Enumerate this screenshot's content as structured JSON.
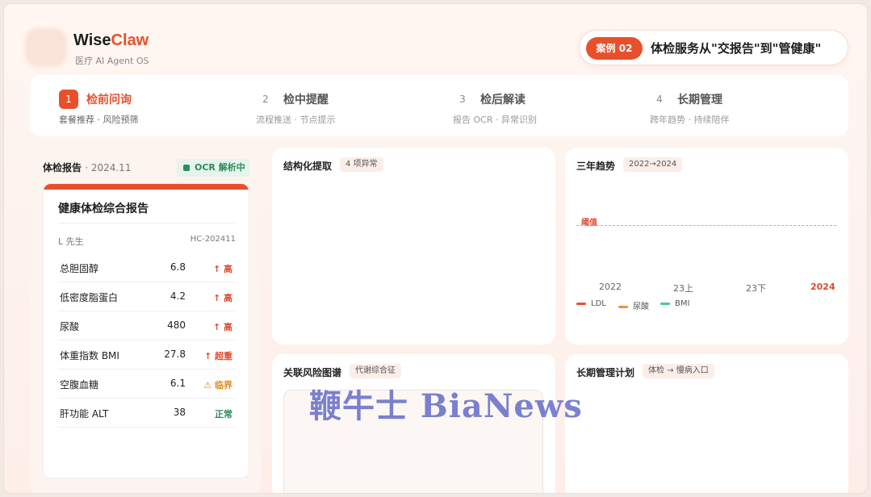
{
  "brand": {
    "name_a": "Wise",
    "name_b": "Claw",
    "tagline": "医疗 AI Agent OS"
  },
  "case": {
    "badge": "案例 02",
    "title": "体检服务从\"交报告\"到\"管健康\""
  },
  "steps": [
    {
      "num": "1",
      "title": "检前问询",
      "sub": "套餐推荐 · 风险预筛",
      "active": true
    },
    {
      "num": "2",
      "title": "检中提醒",
      "sub": "流程推送 · 节点提示",
      "active": false
    },
    {
      "num": "3",
      "title": "检后解读",
      "sub": "报告 OCR · 异常识别",
      "active": false
    },
    {
      "num": "4",
      "title": "长期管理",
      "sub": "跨年趋势 · 持续陪伴",
      "active": false
    }
  ],
  "report": {
    "heading": "体检报告",
    "date": "· 2024.11",
    "ocr_badge": "OCR 解析中",
    "paper_title": "健康体检综合报告",
    "patient": "L 先生",
    "code": "HC-202411",
    "rows": [
      {
        "name": "总胆固醇",
        "value": "6.8",
        "flag": "↑ 高",
        "level": "high"
      },
      {
        "name": "低密度脂蛋白",
        "value": "4.2",
        "flag": "↑ 高",
        "level": "high"
      },
      {
        "name": "尿酸",
        "value": "480",
        "flag": "↑ 高",
        "level": "high"
      },
      {
        "name": "体重指数 BMI",
        "value": "27.8",
        "flag": "↑ 超重",
        "level": "high"
      },
      {
        "name": "空腹血糖",
        "value": "6.1",
        "flag": "⚠ 临界",
        "level": "warn"
      },
      {
        "name": "肝功能 ALT",
        "value": "38",
        "flag": "正常",
        "level": "ok"
      }
    ]
  },
  "structured": {
    "title": "结构化提取",
    "chip": "4 项异常"
  },
  "trend": {
    "title": "三年趋势",
    "chip": "2022→2024",
    "threshold_label": "阈值",
    "x_ticks": [
      "2022",
      "23上",
      "23下",
      "2024"
    ],
    "legend": [
      {
        "name": "LDL",
        "color": "#e8502b"
      },
      {
        "name": "尿酸",
        "color": "#f0922e"
      },
      {
        "name": "BMI",
        "color": "#4cc3a4"
      }
    ]
  },
  "risk": {
    "title": "关联风险图谱",
    "chip": "代谢综合征"
  },
  "plan": {
    "title": "长期管理计划",
    "chip": "体检 → 慢病入口"
  },
  "watermark": "鞭牛士 BiaNews"
}
